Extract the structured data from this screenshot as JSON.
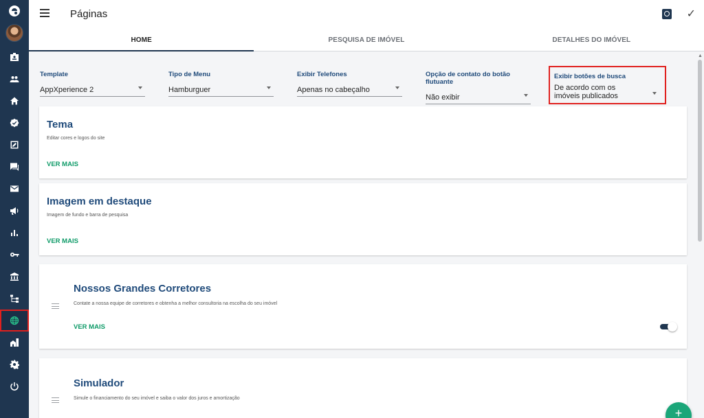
{
  "header": {
    "title": "Páginas"
  },
  "tabs": [
    {
      "label": "HOME"
    },
    {
      "label": "PESQUISA DE IMÓVEL"
    },
    {
      "label": "DETALHES DO IMÓVEL"
    }
  ],
  "fields": [
    {
      "label": "Template",
      "value": "AppXperience 2"
    },
    {
      "label": "Tipo de Menu",
      "value": "Hamburguer"
    },
    {
      "label": "Exibir Telefones",
      "value": "Apenas no cabeçalho"
    },
    {
      "label": "Opção de contato do botão flutuante",
      "value": "Não exibir"
    },
    {
      "label": "Exibir botões de busca",
      "value": "De acordo com os imóveis publicados"
    }
  ],
  "cards": [
    {
      "title": "Tema",
      "description": "Editar cores e logos do site",
      "link": "VER MAIS"
    },
    {
      "title": "Imagem em destaque",
      "description": "Imagem de fundo e barra de pesquisa",
      "link": "VER MAIS"
    },
    {
      "title": "Nossos Grandes Corretores",
      "description": "Contate a nossa equipe de corretores e obtenha a melhor consultoria na escolha do seu imóvel",
      "link": "VER MAIS",
      "enabled": true
    },
    {
      "title": "Simulador",
      "description": "Simule o financiamento do seu imóvel e saiba o valor dos juros e amortização"
    }
  ],
  "fab": {
    "label": "+"
  },
  "colors": {
    "sidebar": "#1f3650",
    "accent_green": "#0d9a67",
    "title_blue": "#1f4a7a",
    "highlight_red": "#e0201e"
  },
  "sidebar_icons": [
    "badge-icon",
    "people-icon",
    "home-icon",
    "verified-icon",
    "edit-square-icon",
    "chat-icon",
    "mail-icon",
    "campaign-icon",
    "bar-chart-icon",
    "key-icon",
    "bank-icon",
    "sitemap-icon",
    "globe-icon",
    "buildings-icon",
    "gear-icon",
    "power-icon"
  ]
}
